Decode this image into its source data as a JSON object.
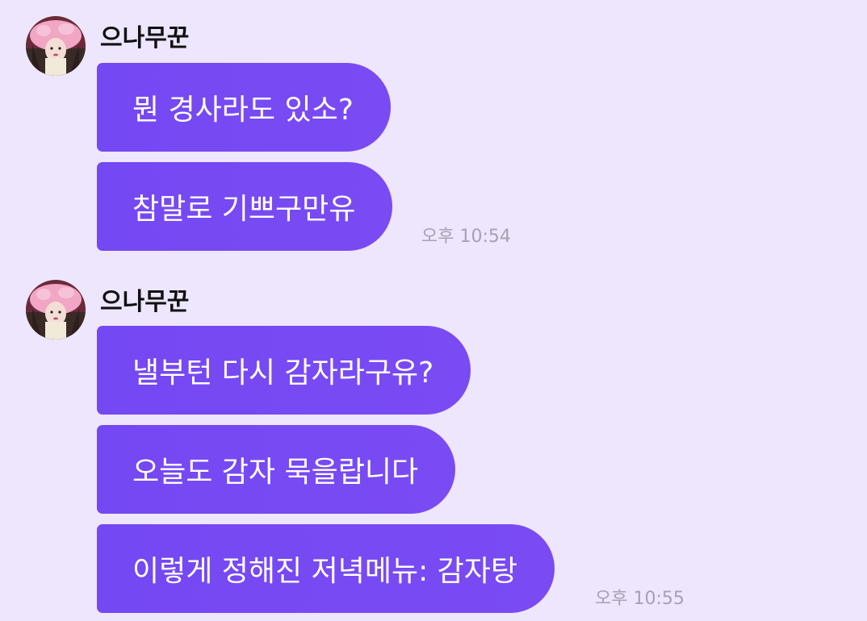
{
  "groups": [
    {
      "sender": "으나무꾼",
      "avatar": "profile-photo",
      "messages": [
        "뭔 경사라도 있소?",
        "참말로 기쁘구만유"
      ],
      "time": "오후 10:54"
    },
    {
      "sender": "으나무꾼",
      "avatar": "profile-photo",
      "messages": [
        "낼부턴 다시 감자라구유?",
        "오늘도 감자 묵을랍니다",
        "이렇게 정해진 저녁메뉴: 감자탕"
      ],
      "time": "오후 10:55"
    }
  ],
  "colors": {
    "background": "#eee6fc",
    "bubble": "#7448f3",
    "bubble_text": "#ffffff",
    "time_text": "#a7a1b5"
  }
}
